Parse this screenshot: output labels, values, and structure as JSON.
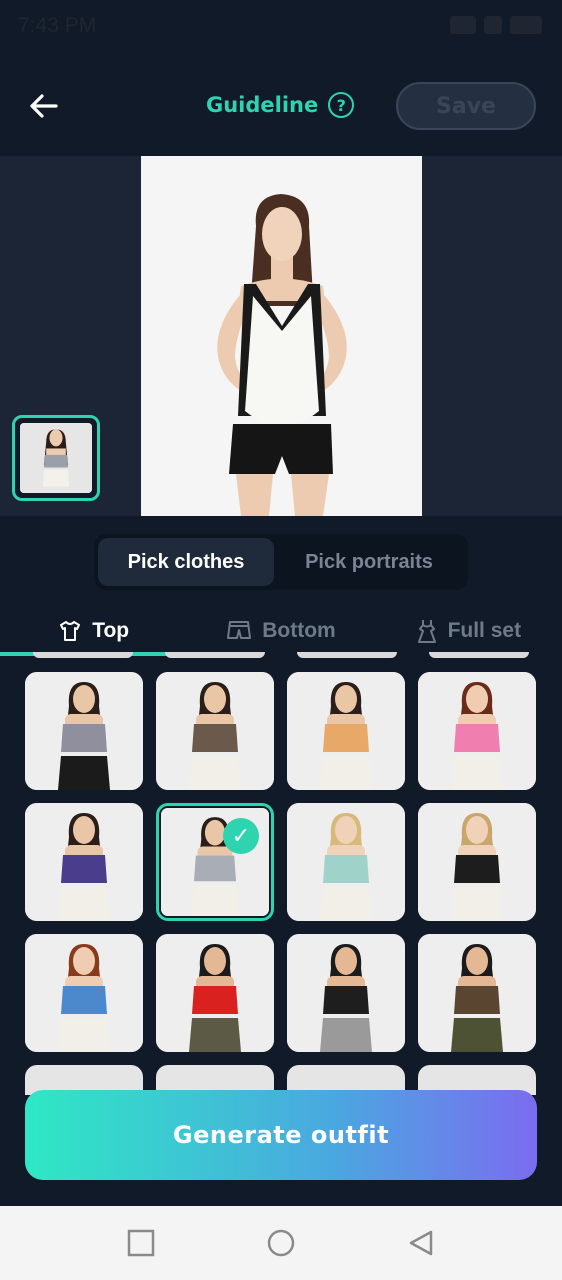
{
  "status": {
    "time": "7:43 PM"
  },
  "header": {
    "guideline_label": "Guideline",
    "save_label": "Save"
  },
  "segments": [
    {
      "label": "Pick clothes",
      "active": true
    },
    {
      "label": "Pick portraits",
      "active": false
    }
  ],
  "categories": [
    {
      "label": "Top",
      "icon": "shirt-icon",
      "active": true
    },
    {
      "label": "Bottom",
      "icon": "shorts-icon",
      "active": false
    },
    {
      "label": "Full set",
      "icon": "dress-icon",
      "active": false
    }
  ],
  "items": [
    {
      "top": "#8f8f9e",
      "bottom": "#1b1b1b",
      "skin": "#e9c6a6",
      "hair": "#2b1e18"
    },
    {
      "top": "#6b5a4b",
      "bottom": "#f2efe8",
      "skin": "#e9c6a6",
      "hair": "#2b1e18"
    },
    {
      "top": "#e8a868",
      "bottom": "#f2efe8",
      "skin": "#e9c6a6",
      "hair": "#2b1e18"
    },
    {
      "top": "#f07fb0",
      "bottom": "#f2efe8",
      "skin": "#f0cdb2",
      "hair": "#6a2b18"
    },
    {
      "top": "#4a3d8c",
      "bottom": "#f2efe8",
      "skin": "#e9c6a6",
      "hair": "#2b1e18"
    },
    {
      "top": "#a9adb5",
      "bottom": "#f2efe8",
      "skin": "#e9c6a6",
      "hair": "#2b1e18",
      "selected": true
    },
    {
      "top": "#9fd2c8",
      "bottom": "#f2efe8",
      "skin": "#f0d2b8",
      "hair": "#d9b87c"
    },
    {
      "top": "#1d1d1d",
      "bottom": "#f2efe8",
      "skin": "#f0d2b8",
      "hair": "#c9a66b"
    },
    {
      "top": "#4c88cc",
      "bottom": "#f2efe8",
      "skin": "#f0cdb2",
      "hair": "#8a3a1c"
    },
    {
      "top": "#d9211f",
      "bottom": "#5c5a44",
      "skin": "#e4b894",
      "hair": "#1b1b1b"
    },
    {
      "top": "#1e1e1e",
      "bottom": "#9a9a9a",
      "skin": "#e4b894",
      "hair": "#1b1b1b"
    },
    {
      "top": "#5a4530",
      "bottom": "#4d5235",
      "skin": "#e4b894",
      "hair": "#1b1b1b"
    }
  ],
  "generate_label": "Generate outfit",
  "colors": {
    "accent": "#2ed3b0",
    "background": "#111a28"
  }
}
